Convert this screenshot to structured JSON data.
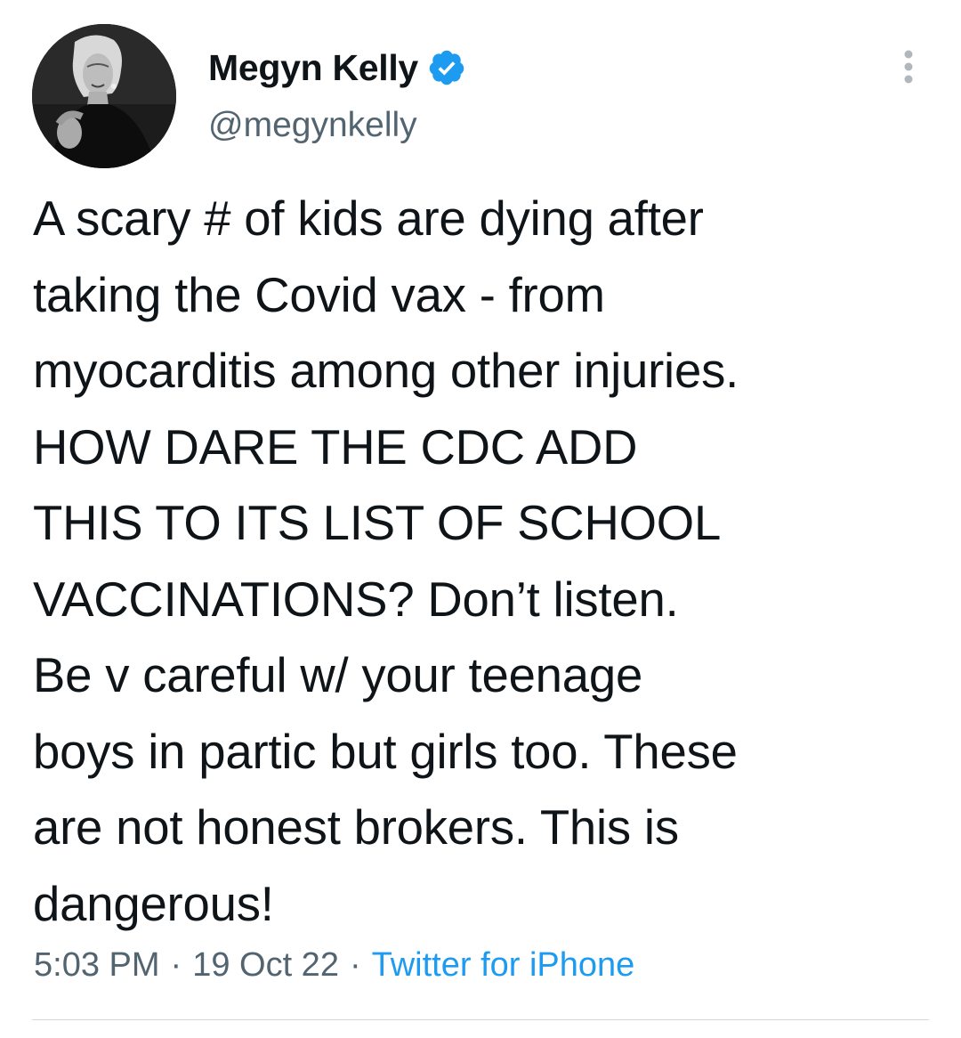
{
  "author": {
    "display_name": "Megyn Kelly",
    "handle": "@megynkelly",
    "verified_icon": "verified-badge-icon",
    "verified_color": "#1d9bf0"
  },
  "tweet": {
    "text": "A scary # of kids are dying after\ntaking the Covid vax - from\nmyocarditis among other injuries.\nHOW DARE THE CDC ADD\nTHIS TO ITS LIST OF SCHOOL\nVACCINATIONS? Don’t listen.\nBe v careful w/ your teenage\nboys in partic but girls too. These\nare not honest brokers. This is\ndangerous!",
    "time": "5:03 PM",
    "separator": "·",
    "date": "19 Oct 22",
    "source": "Twitter for iPhone"
  },
  "menu": {
    "icon": "more-options-icon"
  },
  "colors": {
    "text": "#0f1419",
    "secondary": "#536471",
    "link": "#1d9bf0",
    "divider": "#cfd9de"
  }
}
